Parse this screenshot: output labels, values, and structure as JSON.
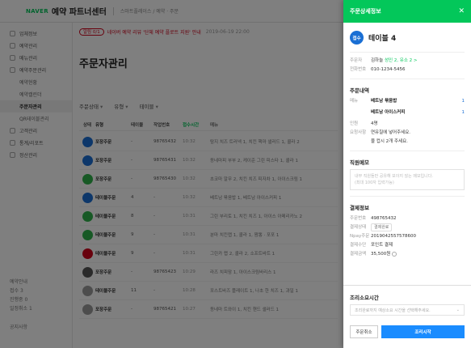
{
  "header": {
    "logo": "NAVER",
    "brand": "예약 파트너센터",
    "sub": "스마트플레이스 / 예약 · 주문"
  },
  "sidebar": {
    "items": [
      {
        "label": "업체정보"
      },
      {
        "label": "예약관리"
      },
      {
        "label": "메뉴관리"
      },
      {
        "label": "예약주문관리"
      }
    ],
    "subitems": [
      {
        "label": "예약현황"
      },
      {
        "label": "예약캘린더"
      },
      {
        "label": "주문자관리"
      },
      {
        "label": "QR테이블관리"
      }
    ],
    "items2": [
      {
        "label": "고객관리"
      },
      {
        "label": "통계/리포트"
      },
      {
        "label": "정산관리"
      }
    ],
    "bottom": [
      "예약안내",
      "접수 3",
      "진행중 0",
      "일정취소 1"
    ],
    "footer": "공지사항"
  },
  "main": {
    "notice_badge": "알림 0/1",
    "notice_text": "네이버 예약 리뷰 '단체 예약 플로트 지원' 안내",
    "notice_date": "2019-06-19 22:00",
    "title": "주문자관리",
    "filters": [
      "주문상태",
      "유형",
      "테이블"
    ],
    "columns": [
      "상태",
      "유형",
      "테이블",
      "작업번호",
      "접수시간",
      "메뉴"
    ],
    "rows": [
      {
        "type": "포장주문",
        "table": "-",
        "num": "98765432",
        "time": "10:32",
        "menu": "탐지 치즈 트러넥 1, 치킨 핵마 샐러드 1, 콜라 2",
        "color": "#1a6fd4"
      },
      {
        "type": "포장주문",
        "table": "-",
        "num": "98765431",
        "time": "10:32",
        "menu": "동네마피 부부 2, 케이준 그린 피스타 1, 콜라 1",
        "color": "#1a6fd4"
      },
      {
        "type": "포장주문",
        "table": "-",
        "num": "98765430",
        "time": "10:32",
        "menu": "초코마 알무 2, 치킨 치즈 피자차 1, 아이스크림 1",
        "color": "#2eb34a"
      },
      {
        "type": "테이블주문",
        "table": "4",
        "num": "-",
        "time": "10:32",
        "menu": "베트남 볶음밥 1, 베트남 아이스커피 1",
        "color": "#1a6fd4"
      },
      {
        "type": "테이블주문",
        "table": "8",
        "num": "-",
        "time": "10:31",
        "menu": "그린 부리토 1, 치킨 치즈 1, 아이스 아메리카노 2",
        "color": "#2eb34a"
      },
      {
        "type": "테이블주문",
        "table": "9",
        "num": "-",
        "time": "10:31",
        "menu": "분마 치킨랩 1, 콜라 1, 짬뽕 · 포포 1",
        "color": "#2eb34a"
      },
      {
        "type": "테이블주문",
        "table": "9",
        "num": "-",
        "time": "10:31",
        "menu": "그린카 랩 2, 콜라 2, 소프트바트 1",
        "color": "#d0021b"
      },
      {
        "type": "포장주문",
        "table": "-",
        "num": "98765423",
        "time": "10:29",
        "menu": "라즈 치피맘 1, 아이스크림바리스 1",
        "color": "#555555"
      },
      {
        "type": "테이블주문",
        "table": "11",
        "num": "-",
        "time": "10:28",
        "menu": "포스트바즈 플레이트 1, 나초 한 치즈 1, 과일 1",
        "color": "#9a9a9a"
      },
      {
        "type": "포장주문",
        "table": "-",
        "num": "98765421",
        "time": "10:27",
        "menu": "동네마 트와이 1, 치킨 핸드 샐러드 1",
        "color": "#9a9a9a"
      }
    ]
  },
  "panel": {
    "title": "주문상세정보",
    "badge": "접수",
    "table_name": "테이블 4",
    "customer_label": "주문자",
    "customer_name": "김하늘",
    "customer_sub": "성인 2, 유소 2 >",
    "phone_label": "전화번호",
    "phone": "010-1234-5456",
    "order_title": "주문내역",
    "menu_label": "메뉴",
    "menu_items": [
      {
        "name": "베트남 볶음밥",
        "qty": "1"
      },
      {
        "name": "베트남 아이스커피",
        "qty": "1"
      }
    ],
    "people_label": "인원",
    "people": "4명",
    "request_label": "요청사항",
    "request_1": "연유칠에 넣어주세요.",
    "request_2": "물 컵시 2개 주세요.",
    "memo_title": "직원메모",
    "memo_placeholder_1": "내부 직원들만 공유해 보이지 않는 메모입니다.",
    "memo_placeholder_2": "(최대 100자 입력가능)",
    "pay_title": "결제정보",
    "pay_num_label": "주문번호",
    "pay_num": "498765432",
    "pay_status_label": "결제상태",
    "pay_status": "결제완료",
    "npay_label": "Npay주문",
    "npay": "2019042557578600",
    "pay_method_label": "결제수단",
    "pay_method": "포인트 결제",
    "pay_amount_label": "결제금액",
    "pay_amount": "35,500원",
    "cook_title": "조리소요시간",
    "cook_placeholder": "조리완료까지 예상소요 시간을 선택해주세요.",
    "cancel_label": "주문취소",
    "start_label": "조리시작"
  }
}
